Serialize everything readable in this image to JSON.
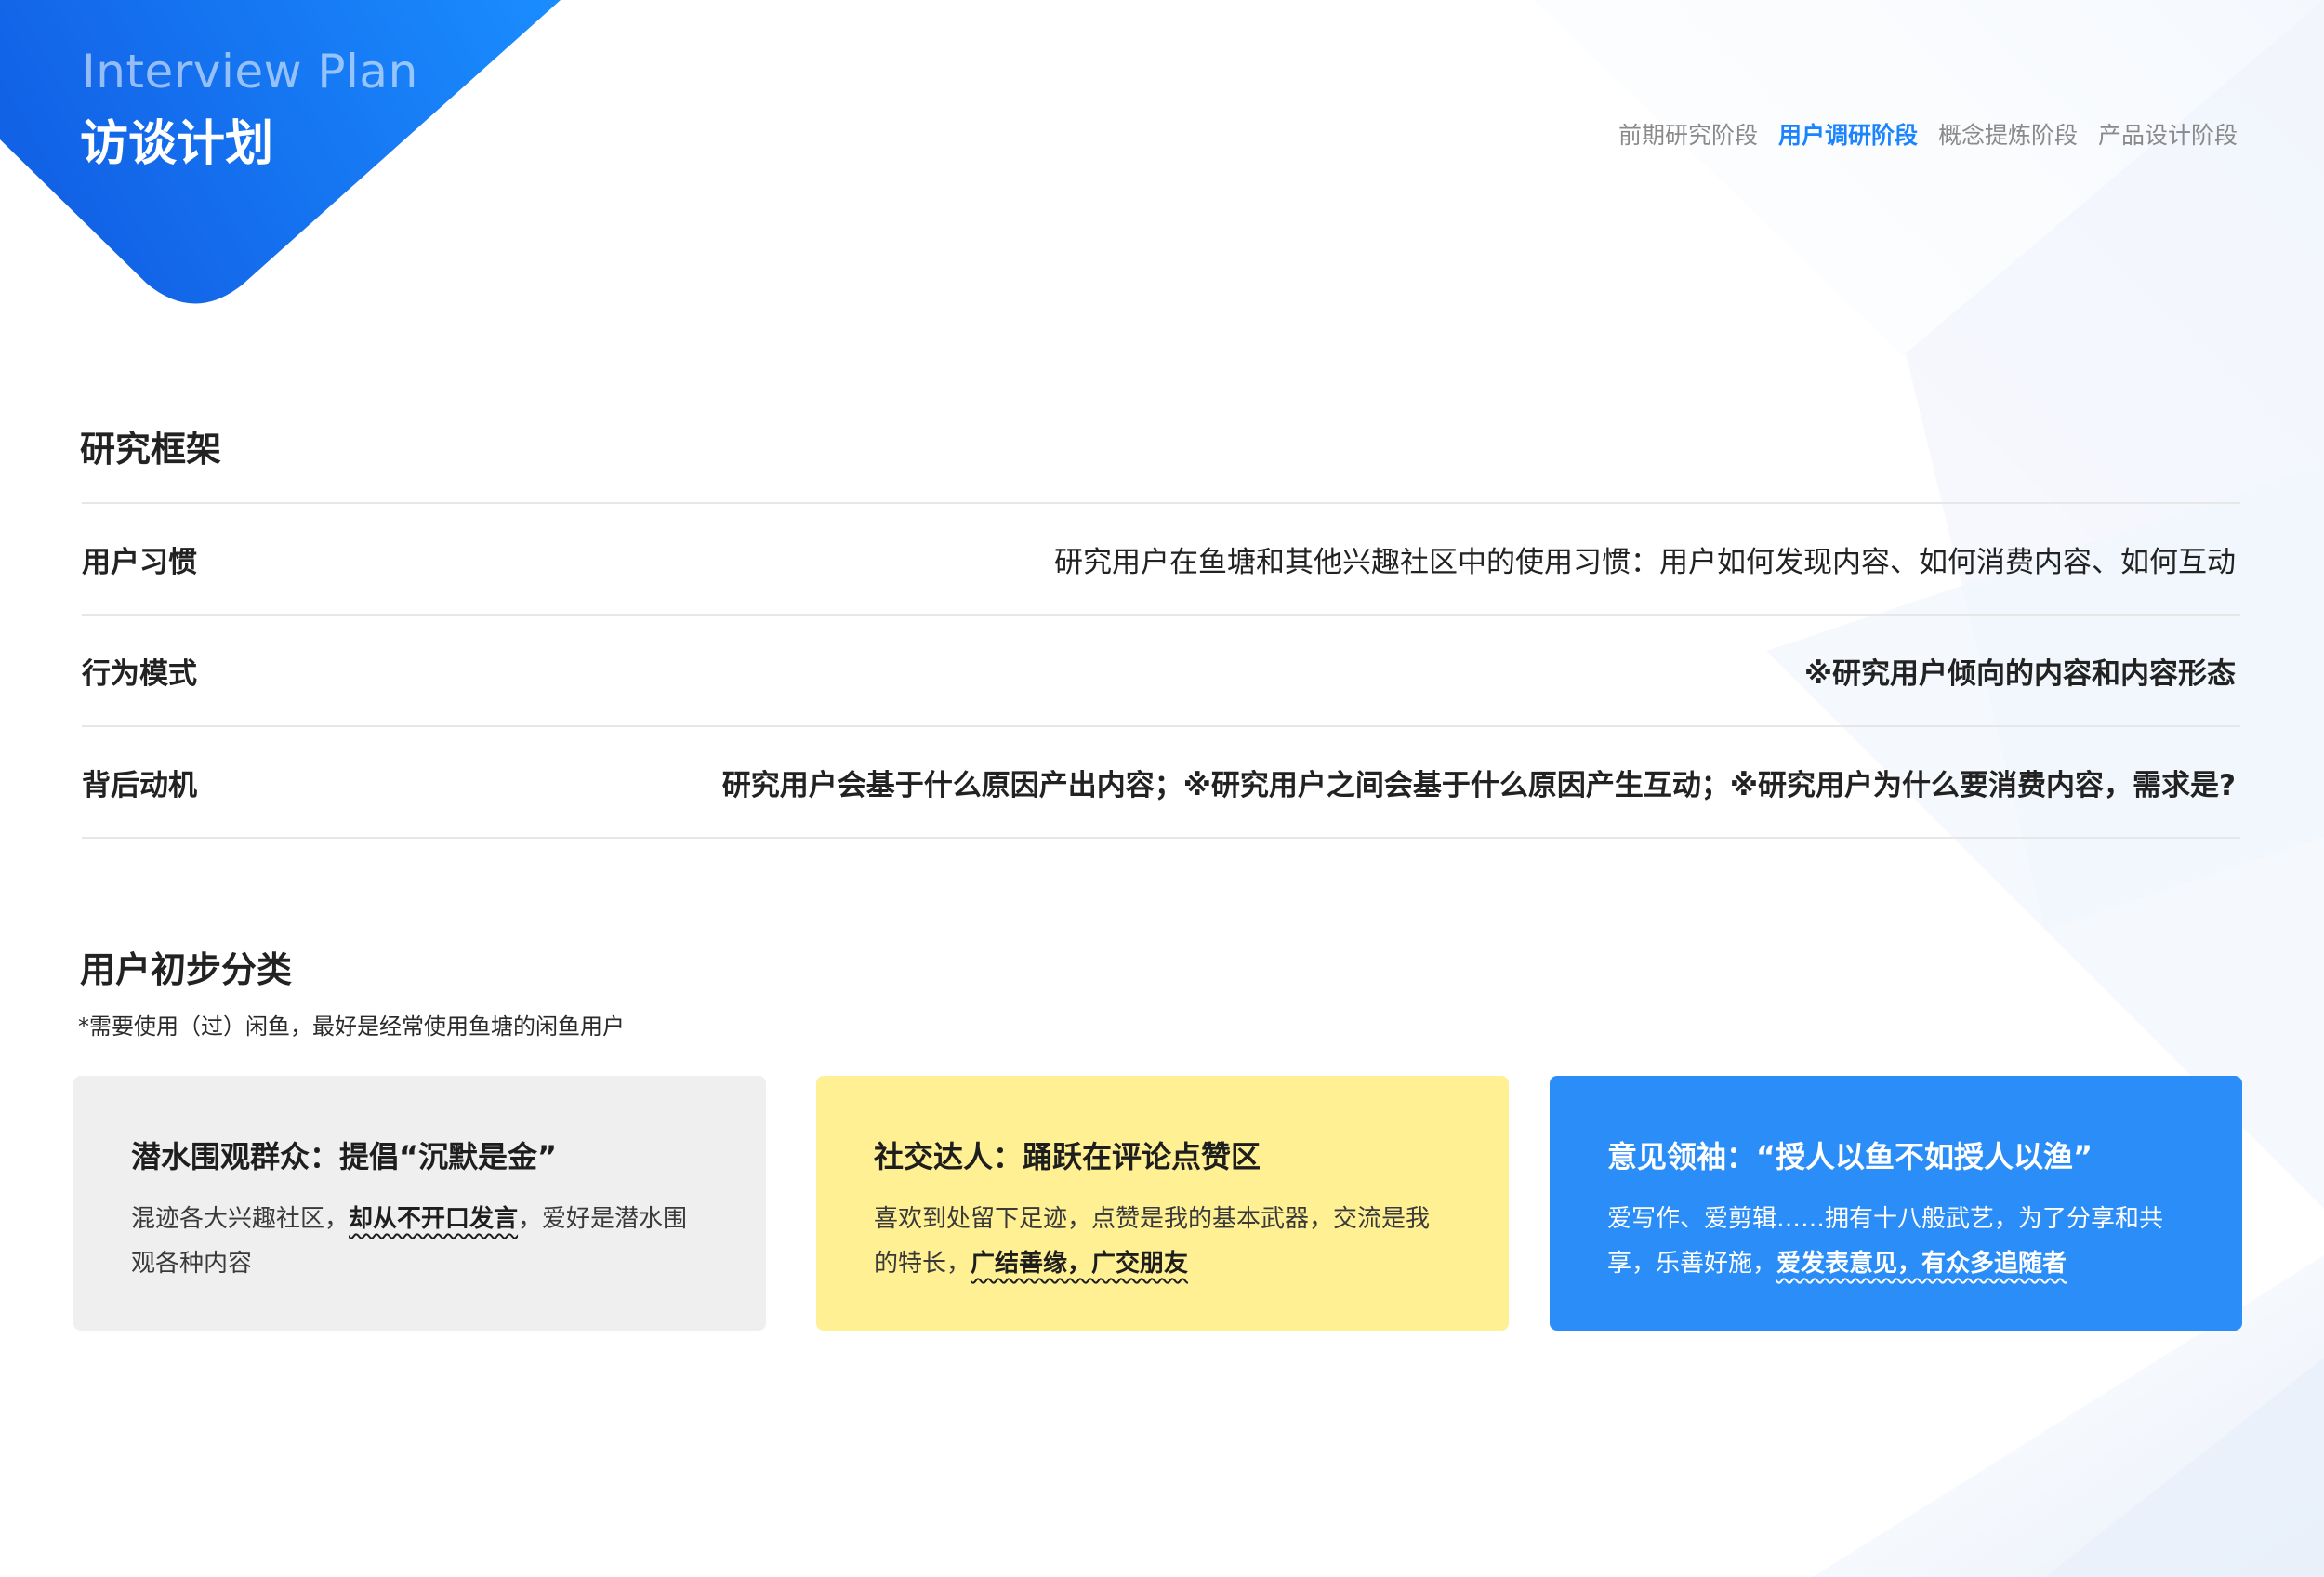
{
  "header": {
    "title_en": "Interview Plan",
    "title_cn": "访谈计划"
  },
  "stage_nav": {
    "items": [
      {
        "label": "前期研究阶段"
      },
      {
        "label": "用户调研阶段",
        "active": true
      },
      {
        "label": "概念提炼阶段"
      },
      {
        "label": "产品设计阶段"
      }
    ]
  },
  "framework": {
    "title": "研究框架",
    "rows": [
      {
        "label": "用户习惯",
        "desc": "研究用户在鱼塘和其他兴趣社区中的使用习惯：用户如何发现内容、如何消费内容、如何互动"
      },
      {
        "label": "行为模式",
        "desc": "※研究用户倾向的内容和内容形态"
      },
      {
        "label": "背后动机",
        "desc": "研究用户会基于什么原因产出内容；※研究用户之间会基于什么原因产生互动；※研究用户为什么要消费内容，需求是?"
      }
    ]
  },
  "categories": {
    "title": "用户初步分类",
    "note": "*需要使用（过）闲鱼，最好是经常使用鱼塘的闲鱼用户",
    "cards": [
      {
        "title": "潜水围观群众：提倡“沉默是金”",
        "text_before": "混迹各大兴趣社区，",
        "text_em": "却从不开口发言",
        "text_after": "，爱好是潜水围观各种内容"
      },
      {
        "title": "社交达人：踊跃在评论点赞区",
        "text_before": "喜欢到处留下足迹，点赞是我的基本武器，交流是我的特长，",
        "text_em": "广结善缘，广交朋友",
        "text_after": ""
      },
      {
        "title": "意见领袖：“授人以鱼不如授人以渔”",
        "text_before": "爱写作、爱剪辑……拥有十八般武艺，为了分享和共享，乐善好施，",
        "text_em": "爱发表意见，有众多追随者",
        "text_after": ""
      }
    ]
  },
  "colors": {
    "brand_blue": "#1a84ff",
    "card_gray": "#efefef",
    "card_yellow": "#fef093",
    "card_blue": "#2b8df7"
  }
}
